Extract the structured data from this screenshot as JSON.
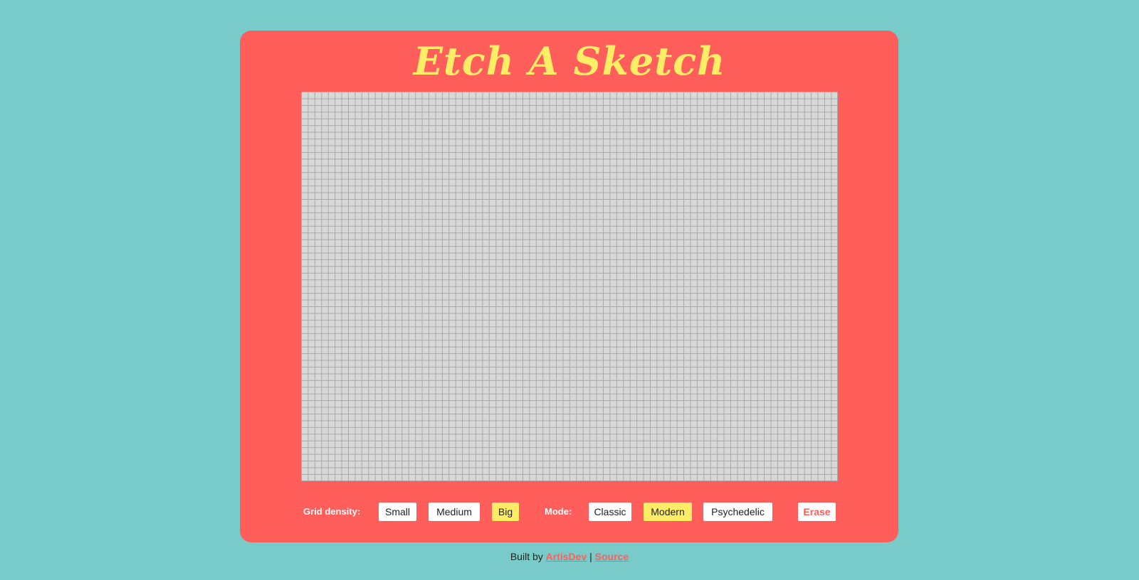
{
  "app": {
    "title": "Etch A Sketch"
  },
  "colors": {
    "background": "#79cbca",
    "frame": "#ff5e5b",
    "accent": "#ffed66",
    "grid_cell": "#d8d8d8",
    "grid_line": "#a9a9a9"
  },
  "grid": {
    "columns": 80,
    "rows": 58
  },
  "controls": {
    "density_label": "Grid density:",
    "density_options": [
      {
        "label": "Small",
        "active": false
      },
      {
        "label": "Medium",
        "active": false
      },
      {
        "label": "Big",
        "active": true
      }
    ],
    "mode_label": "Mode:",
    "mode_options": [
      {
        "label": "Classic",
        "active": false
      },
      {
        "label": "Modern",
        "active": true
      },
      {
        "label": "Psychedelic",
        "active": false
      }
    ],
    "erase_label": "Erase"
  },
  "footer": {
    "prefix": "Built by ",
    "author_link": "ArtisDev",
    "separator": " | ",
    "source_link": "Source"
  }
}
